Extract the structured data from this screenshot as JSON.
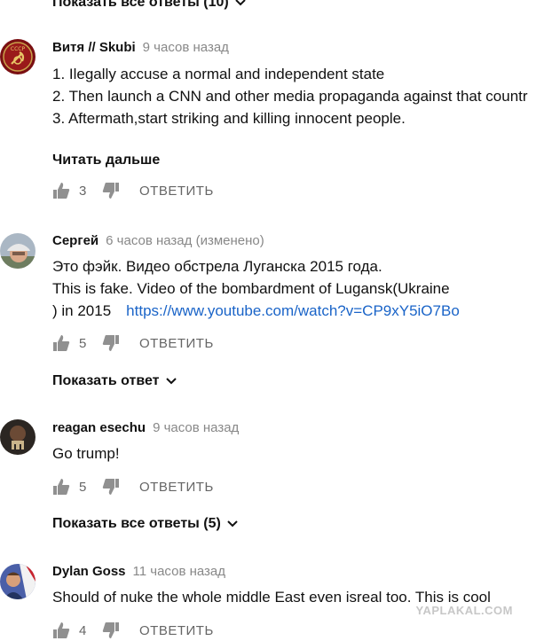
{
  "top_show_replies": "Показать все ответы (10)",
  "comments": [
    {
      "author": "Витя // Skubi",
      "time": "9 часов назад",
      "lines": [
        "1. Ilegally accuse a normal and independent state",
        "2. Then launch a CNN and other media propaganda against that countr",
        "3. Aftermath,start striking and killing innocent people."
      ],
      "read_more": "Читать дальше",
      "likes": "3",
      "reply_label": "ОТВЕТИТЬ"
    },
    {
      "author": "Сергей",
      "time": "6 часов назад (изменено)",
      "lines": [
        "Это фэйк. Видео обстрела Луганска 2015 года.",
        "This is fake. Video of the bombardment of Lugansk(Ukraine"
      ],
      "line3_prefix": ") in 2015",
      "link": "https://www.youtube.com/watch?v=CP9xY5iO7Bo",
      "likes": "5",
      "reply_label": "ОТВЕТИТЬ",
      "show_reply": "Показать ответ"
    },
    {
      "author": "reagan esechu",
      "time": "9 часов назад",
      "lines": [
        "Go trump!"
      ],
      "likes": "5",
      "reply_label": "ОТВЕТИТЬ",
      "show_replies": "Показать все ответы (5)"
    },
    {
      "author": "Dylan Goss",
      "time": "11 часов назад",
      "lines": [
        "Should of nuke the whole middle East even isreal too. This is cool"
      ],
      "likes": "4",
      "reply_label": "ОТВЕТИТЬ"
    }
  ],
  "watermark": "YAPLAKAL.COM"
}
